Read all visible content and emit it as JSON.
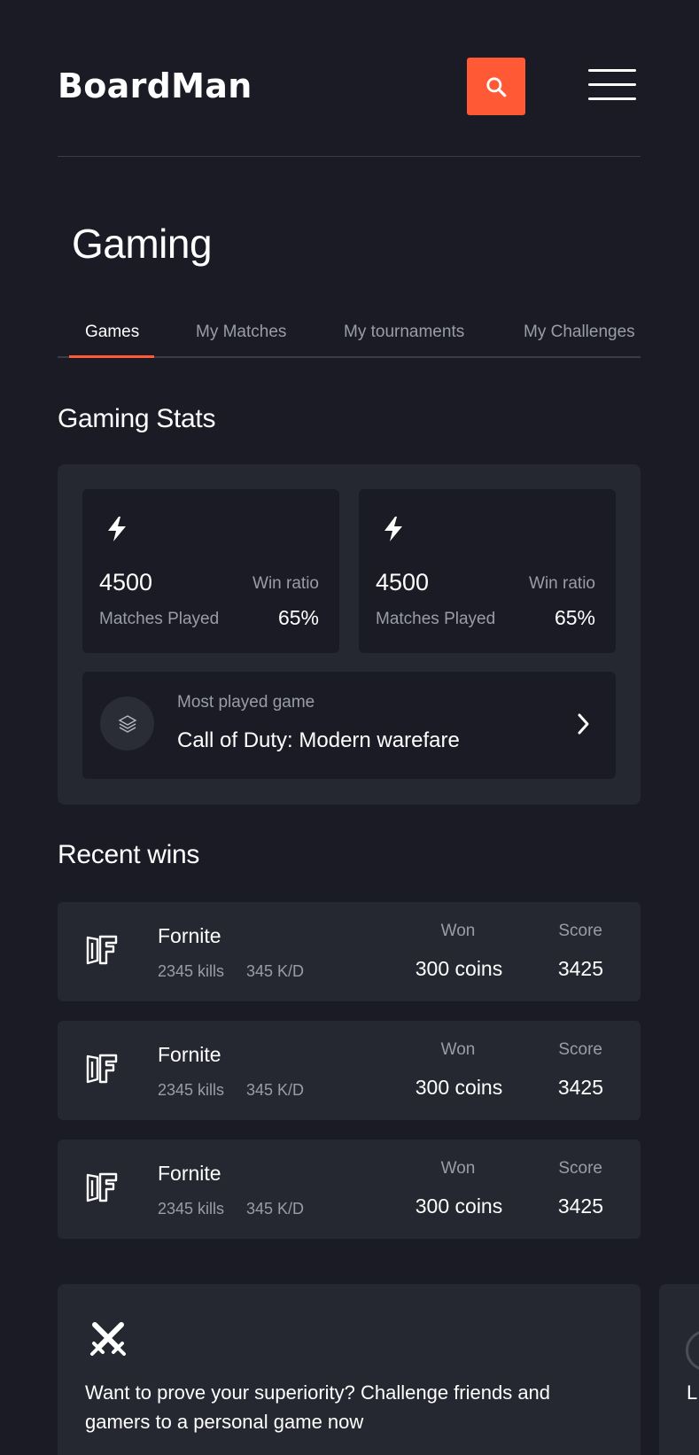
{
  "header": {
    "logo": "BoardMan",
    "search_icon": "search-icon",
    "menu_icon": "hamburger-menu-icon",
    "accent_color": "#ff5a35"
  },
  "page": {
    "title": "Gaming"
  },
  "tabs": [
    {
      "label": "Games",
      "active": true
    },
    {
      "label": "My Matches",
      "active": false
    },
    {
      "label": "My tournaments",
      "active": false
    },
    {
      "label": "My Challenges",
      "active": false
    }
  ],
  "gaming_stats": {
    "title": "Gaming Stats",
    "cards": [
      {
        "icon": "bolt-icon",
        "matches": "4500",
        "matches_label": "Matches Played",
        "ratio_label": "Win ratio",
        "ratio": "65%"
      },
      {
        "icon": "bolt-icon",
        "matches": "4500",
        "matches_label": "Matches Played",
        "ratio_label": "Win ratio",
        "ratio": "65%"
      }
    ],
    "most_played": {
      "icon": "layers-icon",
      "label": "Most played game",
      "game": "Call of Duty: Modern warefare",
      "chevron_icon": "chevron-right-icon"
    }
  },
  "recent_wins": {
    "title": "Recent wins",
    "items": [
      {
        "icon": "fortnite-icon",
        "game": "Fornite",
        "kills": "2345 kills",
        "kd": "345 K/D",
        "won_label": "Won",
        "won": "300 coins",
        "score_label": "Score",
        "score": "3425"
      },
      {
        "icon": "fortnite-icon",
        "game": "Fornite",
        "kills": "2345 kills",
        "kd": "345 K/D",
        "won_label": "Won",
        "won": "300 coins",
        "score_label": "Score",
        "score": "3425"
      },
      {
        "icon": "fortnite-icon",
        "game": "Fornite",
        "kills": "2345 kills",
        "kd": "345 K/D",
        "won_label": "Won",
        "won": "300 coins",
        "score_label": "Score",
        "score": "3425"
      }
    ]
  },
  "challenge": {
    "icon": "crossed-swords-icon",
    "text": "Want to prove your superiority? Challenge friends and gamers to a personal game now"
  },
  "challenge_2": {
    "text_fragment": "L e"
  }
}
